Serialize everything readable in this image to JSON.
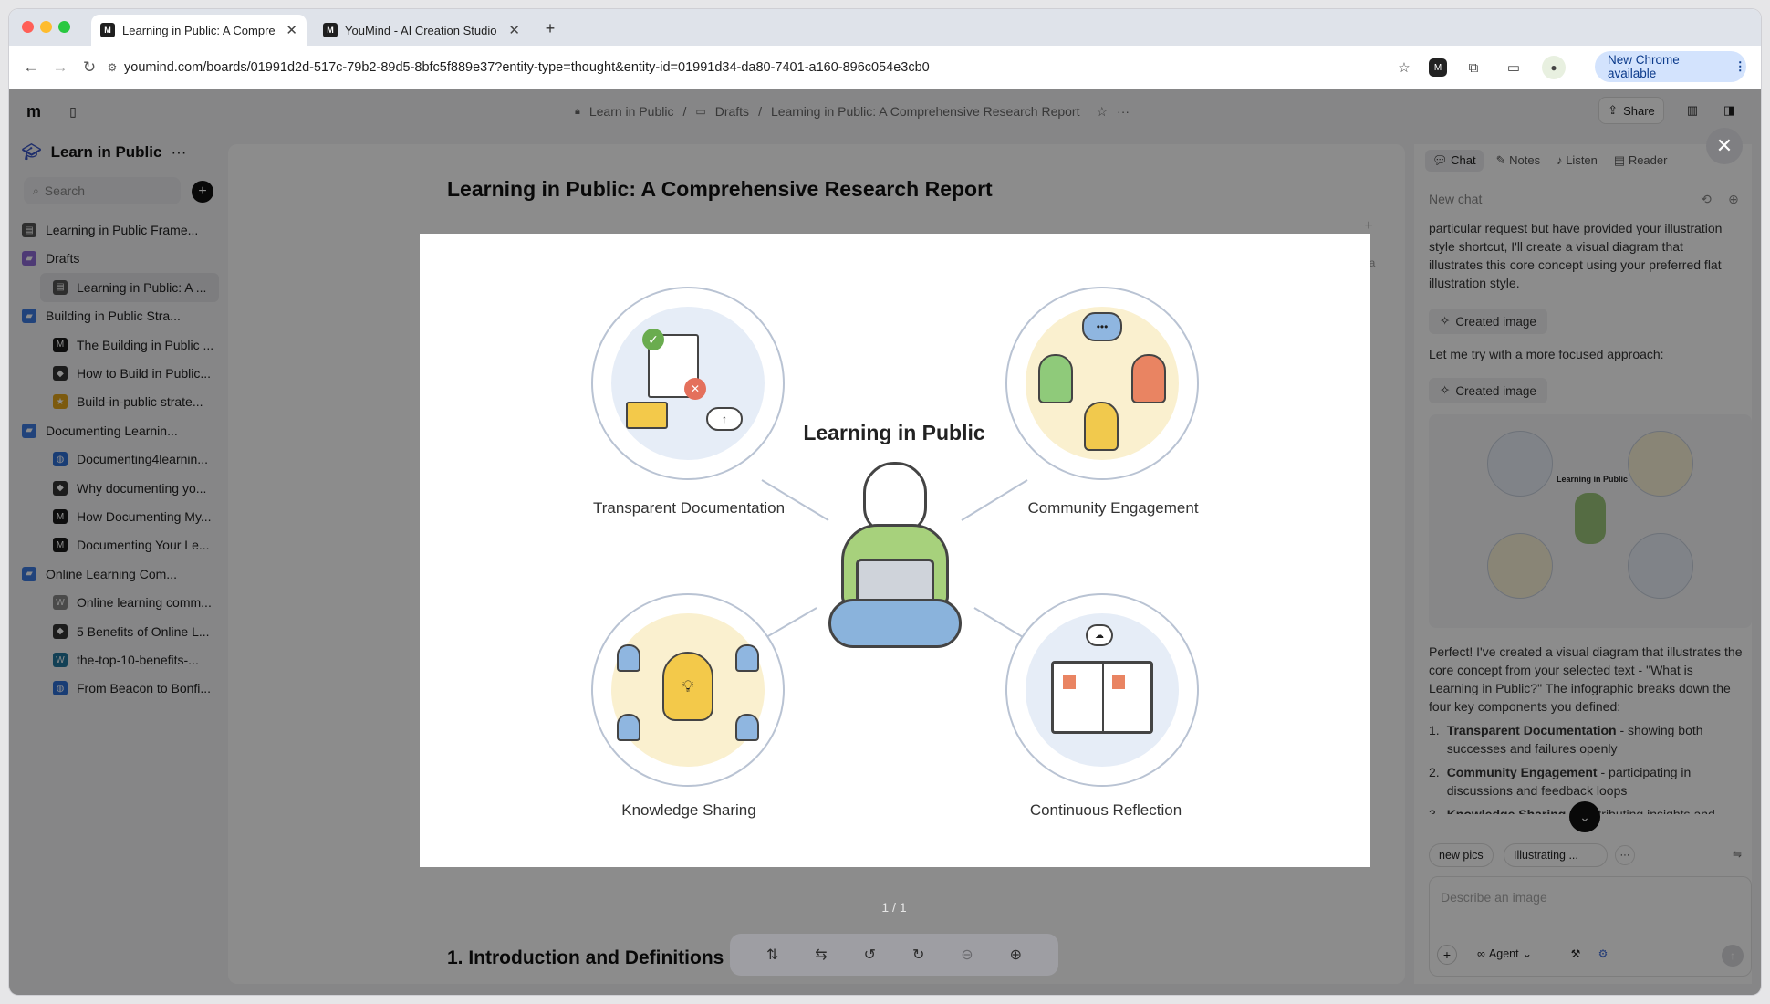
{
  "browser": {
    "tabs": [
      {
        "title": "Learning in Public: A Compre",
        "favicon": "M"
      },
      {
        "title": "YouMind - AI Creation Studio",
        "favicon": "M"
      }
    ],
    "url": "youmind.com/boards/01991d2d-517c-79b2-89d5-8bfc5f889e37?entity-type=thought&entity-id=01991d34-da80-7401-a160-896c054e3cb0",
    "update_label": "New Chrome available"
  },
  "header": {
    "breadcrumb": [
      "Learn in Public",
      "Drafts",
      "Learning in Public: A Comprehensive Research Report"
    ],
    "share_label": "Share"
  },
  "sidebar": {
    "board_title": "Learn in Public",
    "search_placeholder": "Search",
    "items": [
      {
        "label": "Learning in Public Frame...",
        "level": 0,
        "icon": "doc"
      },
      {
        "label": "Drafts",
        "level": 0,
        "icon": "folder-purple"
      },
      {
        "label": "Learning in Public: A ...",
        "level": 1,
        "icon": "doc",
        "active": true
      },
      {
        "label": "Building in Public Stra...",
        "level": 0,
        "icon": "folder"
      },
      {
        "label": "The Building in Public ...",
        "level": 1,
        "icon": "medium"
      },
      {
        "label": "How to Build in Public...",
        "level": 1,
        "icon": "site"
      },
      {
        "label": "Build-in-public strate...",
        "level": 1,
        "icon": "star"
      },
      {
        "label": "Documenting Learnin...",
        "level": 0,
        "icon": "folder"
      },
      {
        "label": "Documenting4learnin...",
        "level": 1,
        "icon": "globe"
      },
      {
        "label": "Why documenting yo...",
        "level": 1,
        "icon": "site"
      },
      {
        "label": "How Documenting My...",
        "level": 1,
        "icon": "medium"
      },
      {
        "label": "Documenting Your Le...",
        "level": 1,
        "icon": "medium"
      },
      {
        "label": "Online Learning Com...",
        "level": 0,
        "icon": "folder"
      },
      {
        "label": "Online learning comm...",
        "level": 1,
        "icon": "wiki"
      },
      {
        "label": "5 Benefits of Online L...",
        "level": 1,
        "icon": "site"
      },
      {
        "label": "the-top-10-benefits-...",
        "level": 1,
        "icon": "wp"
      },
      {
        "label": "From Beacon to Bonfi...",
        "level": 1,
        "icon": "globe"
      }
    ]
  },
  "document": {
    "title": "Learning in Public: A Comprehensive Research Report",
    "section_heading": "1. Introduction and Definitions"
  },
  "chat": {
    "tabs": [
      "Chat",
      "Notes",
      "Listen",
      "Reader"
    ],
    "new_chat_label": "New chat",
    "message_1": "particular request but have provided your illustration style shortcut, I'll create a visual diagram that illustrates this core concept using your preferred flat illustration style.",
    "created_image_label": "Created image",
    "message_2": "Let me try with a more focused approach:",
    "thumb_title": "Learning in Public",
    "message_3": "Perfect! I've created a visual diagram that illustrates the core concept from your selected text - \"What is Learning in Public?\" The infographic breaks down the four key components you defined:",
    "list": [
      {
        "bold": "Transparent Documentation",
        "rest": " - showing both successes and failures openly"
      },
      {
        "bold": "Community Engagement",
        "rest": " - participating in discussions and feedback loops"
      },
      {
        "bold": "Knowledge Sharing",
        "rest": " - contributing insights and resources to benefit others"
      }
    ],
    "chips": [
      "new pics",
      "Illustrating ..."
    ],
    "input_placeholder": "Describe an image",
    "agent_label": "Agent"
  },
  "lightbox": {
    "center_title": "Learning in Public",
    "captions": [
      "Transparent Documentation",
      "Community Engagement",
      "Knowledge Sharing",
      "Continuous Reflection"
    ],
    "page_indicator": "1 / 1"
  }
}
